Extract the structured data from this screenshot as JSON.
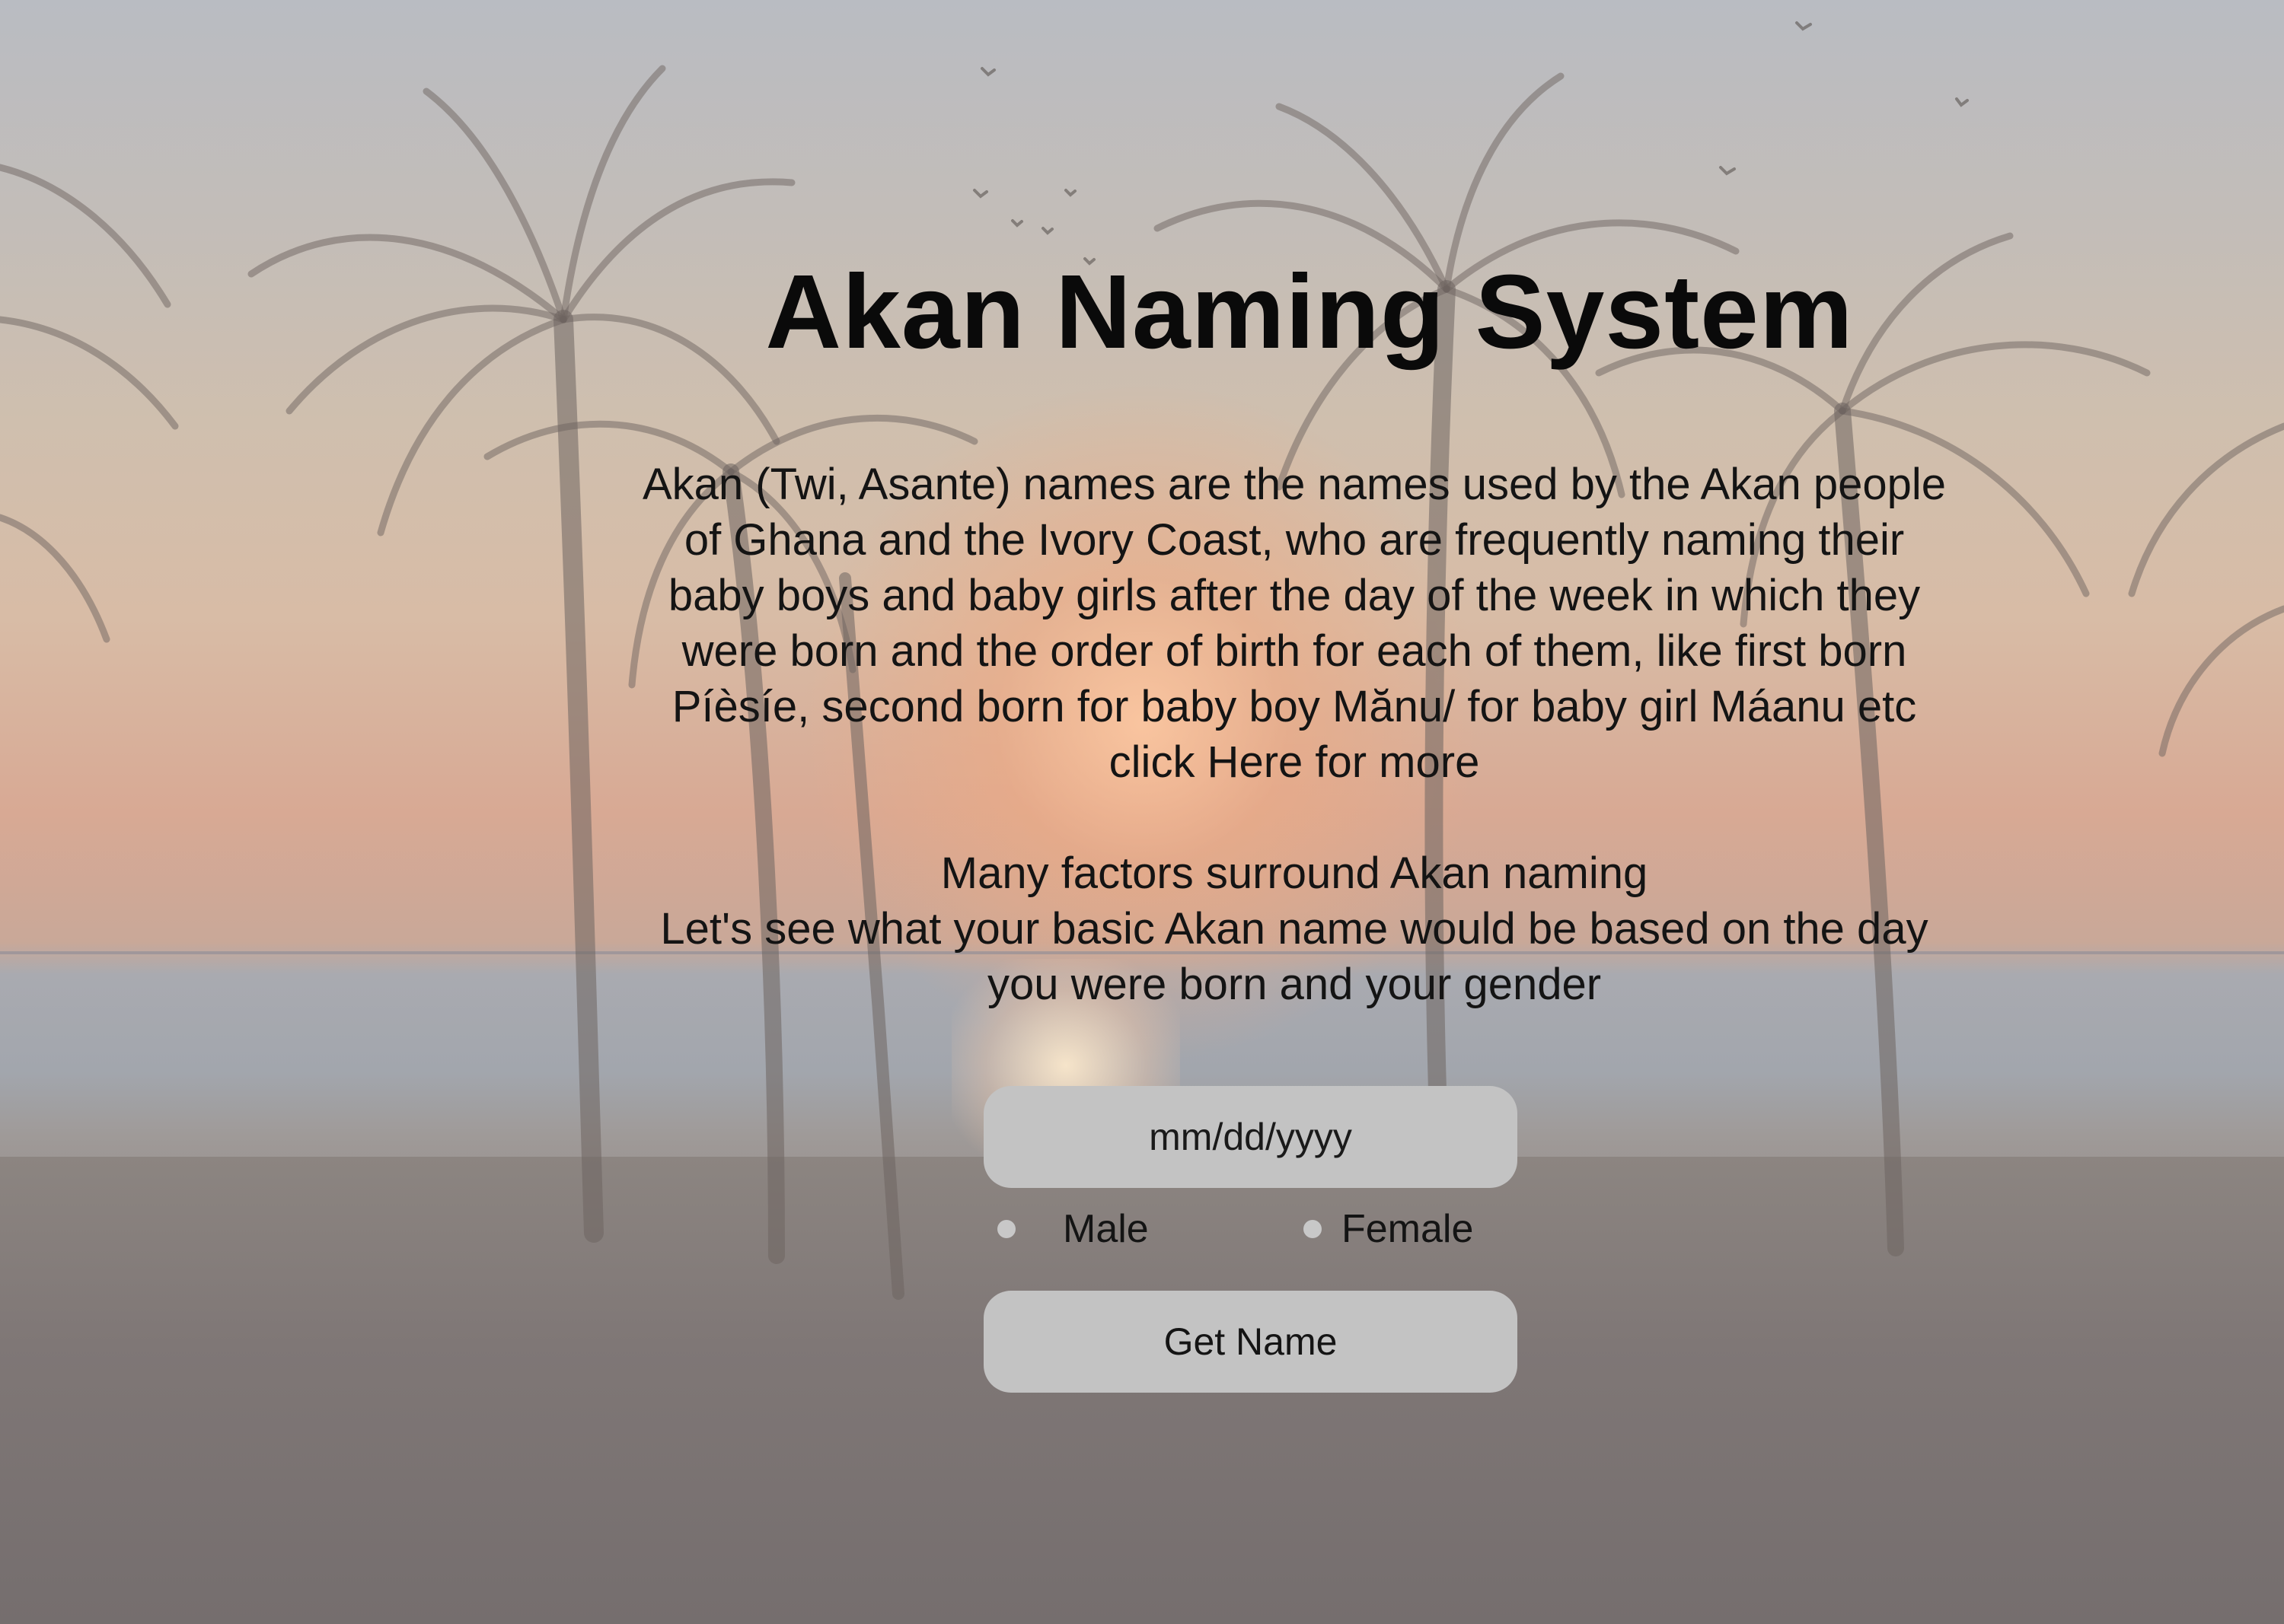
{
  "page": {
    "title": "Akan Naming System",
    "description_lines": [
      "Akan (Twi, Asante) names are the names used by the Akan people",
      "of Ghana and the Ivory Coast, who are frequently naming their",
      "baby boys and baby girls after the day of the week in which they",
      "were born and the order of birth for each of them, like first born",
      "Píèsíe, second born for baby boy Mănu/ for baby girl Máanu etc",
      "click Here for more",
      "Many factors surround Akan naming",
      "Let's see what your basic Akan name would be based on the day",
      "you were born and your gender"
    ]
  },
  "form": {
    "date_placeholder": "mm/dd/yyyy",
    "gender_options": {
      "male": "Male",
      "female": "Female"
    },
    "submit_label": "Get Name"
  },
  "colors": {
    "input_bg": "#c3c3c3",
    "title_text": "#0a0a0a",
    "body_text": "#141414"
  }
}
